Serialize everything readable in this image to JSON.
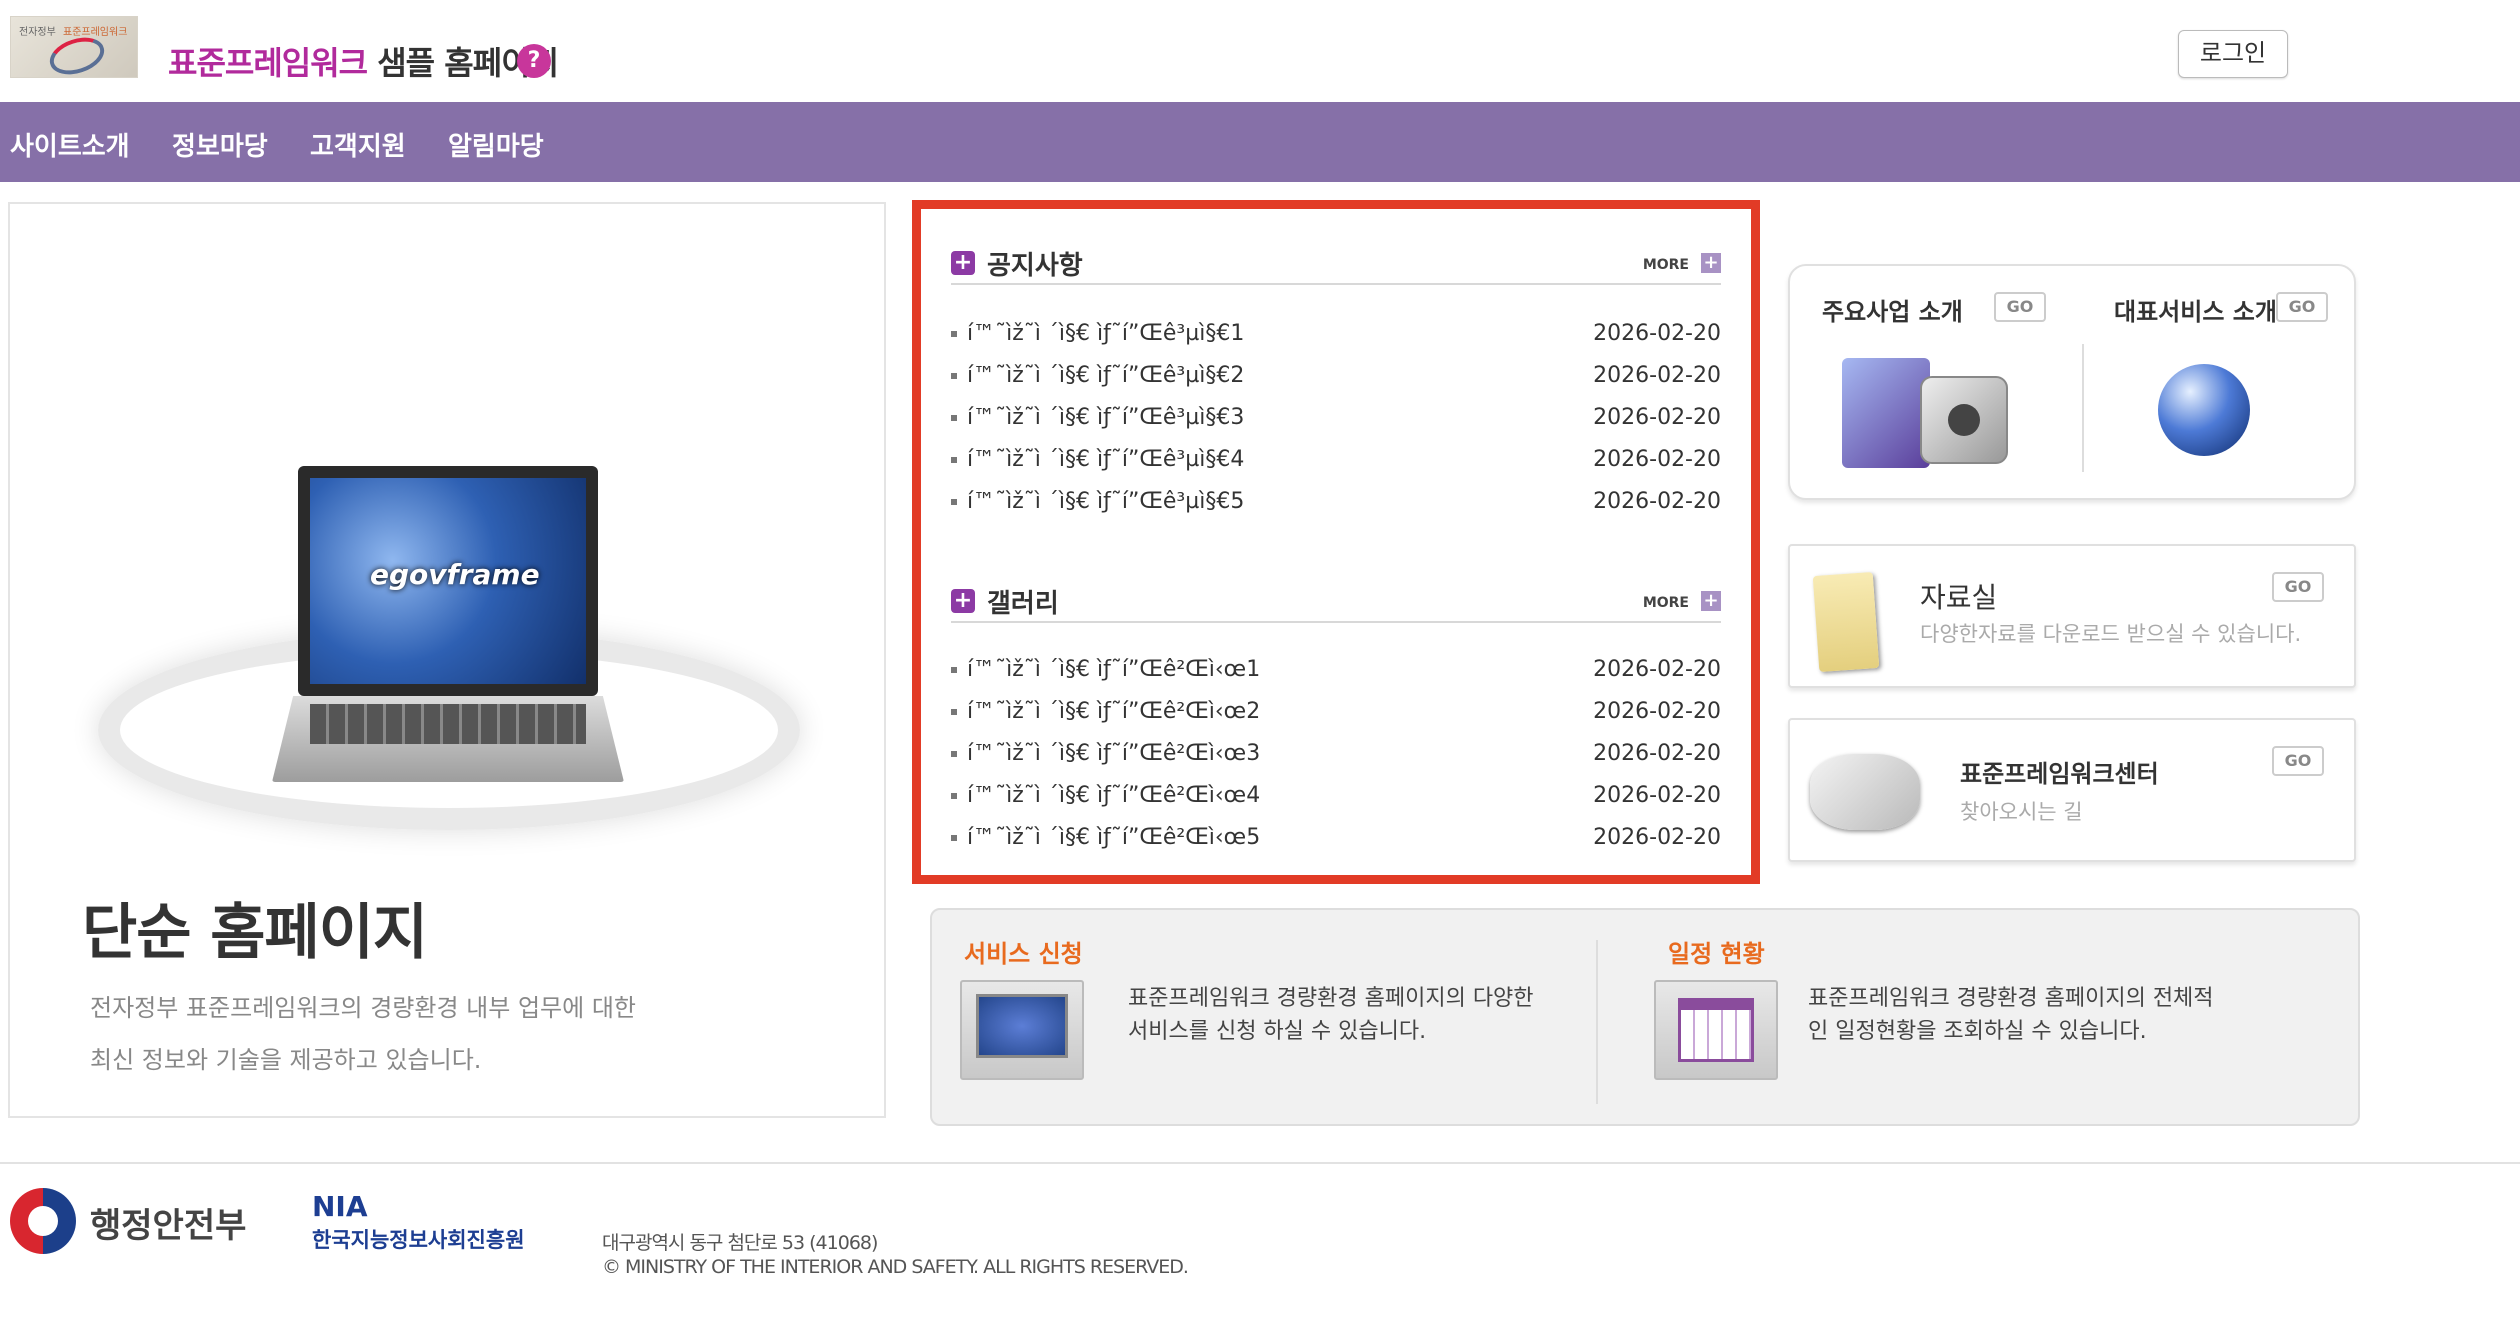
{
  "header": {
    "logo_text_left": "전자정부",
    "logo_text_right": "표준프레임워크",
    "title_pink": "표준프레임워크",
    "title_dark": " 샘플 홈페이지",
    "help_icon": "?",
    "login_label": "로그인"
  },
  "nav": {
    "items": [
      "사이트소개",
      "정보마당",
      "고객지원",
      "알림마당"
    ]
  },
  "hero": {
    "screen_text": "egovframe",
    "title": "단순 홈페이지",
    "desc_line1": "전자정부 표준프레임워크의 경량환경 내부 업무에 대한",
    "desc_line2": "최신 정보와 기술을 제공하고 있습니다."
  },
  "notice": {
    "title": "공지사항",
    "more": "MORE",
    "more_plus": "+",
    "items": [
      {
        "title": "í™˜ìž˜ì   ´ì§€ ìƒ˜í”Œê³µì§€1",
        "date": "2026-02-20"
      },
      {
        "title": "í™˜ìž˜ì   ´ì§€ ìƒ˜í”Œê³µì§€2",
        "date": "2026-02-20"
      },
      {
        "title": "í™˜ìž˜ì   ´ì§€ ìƒ˜í”Œê³µì§€3",
        "date": "2026-02-20"
      },
      {
        "title": "í™˜ìž˜ì   ´ì§€ ìƒ˜í”Œê³µì§€4",
        "date": "2026-02-20"
      },
      {
        "title": "í™˜ìž˜ì   ´ì§€ ìƒ˜í”Œê³µì§€5",
        "date": "2026-02-20"
      }
    ]
  },
  "gallery": {
    "title": "갤러리",
    "more": "MORE",
    "more_plus": "+",
    "items": [
      {
        "title": "í™˜ìž˜ì   ´ì§€ ìƒ˜í”Œê²Œì‹œ1",
        "date": "2026-02-20"
      },
      {
        "title": "í™˜ìž˜ì   ´ì§€ ìƒ˜í”Œê²Œì‹œ2",
        "date": "2026-02-20"
      },
      {
        "title": "í™˜ìž˜ì   ´ì§€ ìƒ˜í”Œê²Œì‹œ3",
        "date": "2026-02-20"
      },
      {
        "title": "í™˜ìž˜ì   ´ì§€ ìƒ˜í”Œê²Œì‹œ4",
        "date": "2026-02-20"
      },
      {
        "title": "í™˜ìž˜ì   ´ì§€ ìƒ˜í”Œê²Œì‹œ5",
        "date": "2026-02-20"
      }
    ]
  },
  "cards": {
    "main_business": "주요사업 소개",
    "main_service": "대표서비스 소개",
    "go": "GO",
    "library_title": "자료실",
    "library_sub": "다양한자료를 다운로드 받으실 수 있습니다.",
    "center_title": "표준프레임워크센터",
    "center_sub": "찾아오시는 길"
  },
  "services": {
    "apply_title": "서비스 신청",
    "apply_line1": "표준프레임워크 경량환경 홈페이지의 다양한",
    "apply_line2": "서비스를 신청 하실 수 있습니다.",
    "schedule_title": "일정 현황",
    "schedule_line1": "표준프레임워크 경량환경 홈페이지의 전체적",
    "schedule_line2": "인 일정현황을 조회하실 수 있습니다."
  },
  "footer": {
    "ministry": "행정안전부",
    "nia_title": "NIA",
    "nia_sub": "한국지능정보사회진흥원",
    "address": "대구광역시 동구 첨단로 53 (41068)",
    "copyright": "© MINISTRY OF THE INTERIOR AND SAFETY. ALL RIGHTS RESERVED."
  },
  "colors": {
    "nav_bg": "#8670a8",
    "title_pink": "#b12a9c",
    "highlight_border": "#e23b26",
    "service_title": "#e86a1e",
    "nia_blue": "#1d3e92"
  }
}
